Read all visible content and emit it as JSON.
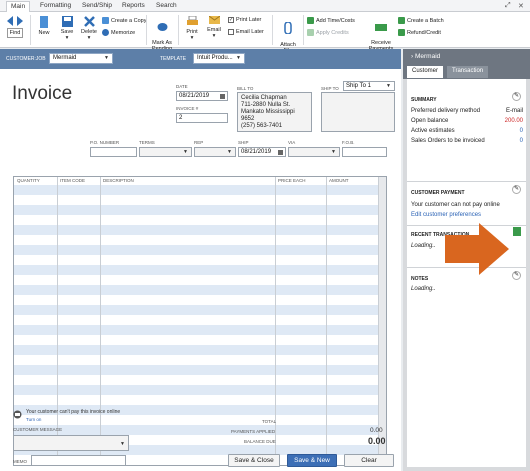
{
  "ribbon": {
    "tabs": [
      "Main",
      "Formatting",
      "Send/Ship",
      "Reports",
      "Search"
    ],
    "find": "Find",
    "new": "New",
    "save": "Save",
    "delete": "Delete",
    "create_copy": "Create a Copy",
    "memorize": "Memorize",
    "mark_as_pending": "Mark As\nPending",
    "print": "Print",
    "email": "Email",
    "print_later": "Print Later",
    "email_later": "Email Later",
    "attach_file": "Attach\nFile",
    "add_time_costs": "Add Time/Costs",
    "apply_credits": "Apply Credits",
    "receive_payments": "Receive\nPayments",
    "create_batch": "Create a Batch",
    "refund_credit": "Refund/Credit"
  },
  "customer_bar": {
    "customer_job_label": "CUSTOMER:JOB",
    "customer_job_value": "Mermaid",
    "template_label": "TEMPLATE",
    "template_value": "Intuit Produ..."
  },
  "form": {
    "title": "Invoice",
    "date_label": "DATE",
    "date_value": "08/21/2019",
    "invoice_no_label": "INVOICE #",
    "invoice_no_value": "2",
    "bill_to_label": "BILL TO",
    "bill_to_lines": [
      "Cecilia Chapman",
      "711-2880 Nulla St.",
      "Mankato Mississippi 9652",
      "(257) 563-7401"
    ],
    "ship_to_label": "SHIP TO",
    "ship_to_value": "Ship To 1",
    "po_label": "P.O. NUMBER",
    "terms_label": "TERMS",
    "rep_label": "REP",
    "ship_label": "SHIP",
    "ship_value": "08/21/2019",
    "via_label": "VIA",
    "fob_label": "F.O.B.",
    "columns": [
      "QUANTITY",
      "ITEM CODE",
      "DESCRIPTION",
      "PRICE EACH",
      "AMOUNT"
    ]
  },
  "footer": {
    "online_msg": "Your customer can't pay this invoice online",
    "turn_on": "Turn on",
    "customer_message_label": "CUSTOMER MESSAGE",
    "memo_label": "MEMO",
    "total_label": "TOTAL",
    "payments_applied_label": "PAYMENTS APPLIED",
    "payments_applied_value": "0.00",
    "balance_due_label": "BALANCE DUE",
    "balance_due_value": "0.00",
    "save_close": "Save & Close",
    "save_new": "Save & New",
    "clear": "Clear"
  },
  "panel": {
    "title": "Mermaid",
    "tabs": [
      "Customer",
      "Transaction"
    ],
    "summary_title": "SUMMARY",
    "summary": [
      {
        "label": "Preferred delivery method",
        "value": "E-mail"
      },
      {
        "label": "Open balance",
        "value": "200.00"
      },
      {
        "label": "Active estimates",
        "value": "0"
      },
      {
        "label": "Sales Orders to be invoiced",
        "value": "0"
      }
    ],
    "customer_payment_title": "CUSTOMER PAYMENT",
    "customer_payment_msg": "Your customer can not pay online",
    "customer_payment_link": "Edit customer preferences",
    "recent_title": "RECENT TRANSACTION",
    "recent_loading": "Loading..",
    "notes_title": "NOTES",
    "notes_loading": "Loading..",
    "open_balance_color": "#cc2222",
    "value_color": "#2a62b5"
  }
}
